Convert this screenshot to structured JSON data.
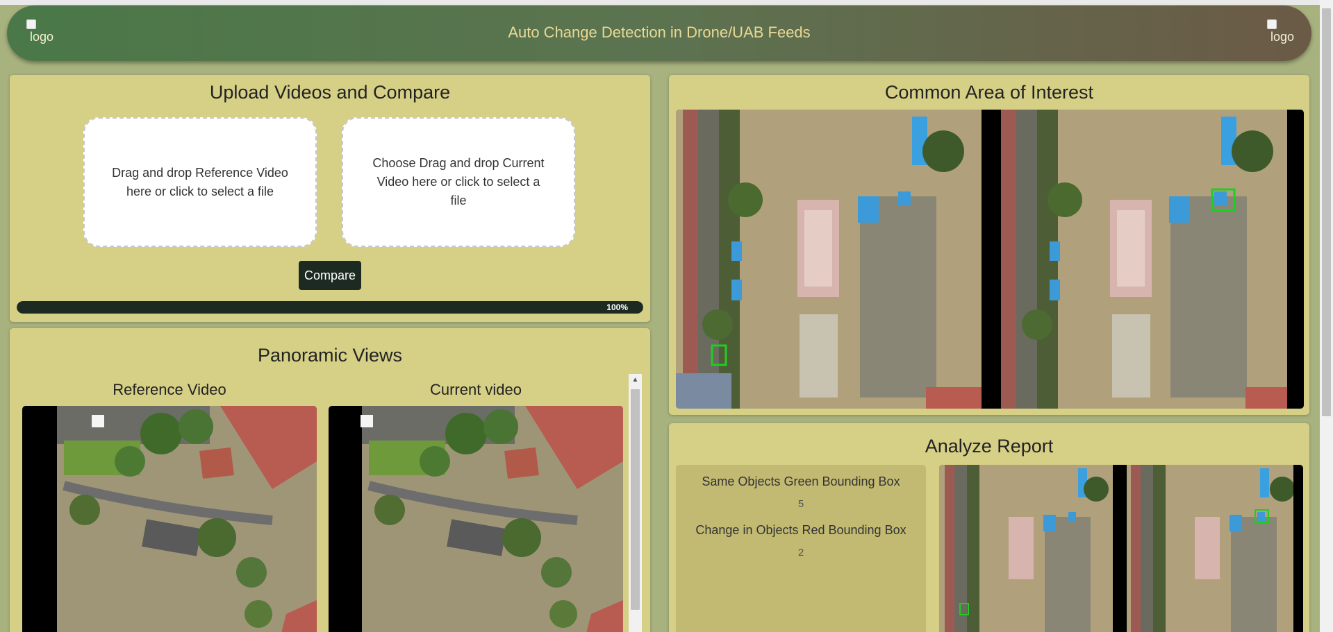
{
  "header": {
    "title": "Auto Change Detection in Drone/UAB Feeds",
    "logo_left_alt": "logo",
    "logo_right_alt": "logo"
  },
  "upload": {
    "title": "Upload Videos and Compare",
    "reference_dropzone": "Drag and drop Reference Video here or click to select a file",
    "current_dropzone": "Choose Drag and drop Current Video here or click to select a file",
    "compare_label": "Compare",
    "progress_text": "100%",
    "progress_value": 1.0
  },
  "panoramic": {
    "title": "Panoramic Views",
    "reference_label": "Reference Video",
    "current_label": "Current video"
  },
  "common_area": {
    "title": "Common Area of Interest"
  },
  "report": {
    "title": "Analyze Report",
    "same_objects_label": "Same Objects Green Bounding Box",
    "same_objects_count": "5",
    "changed_objects_label": "Change in Objects Red Bounding Box",
    "changed_objects_count": "2"
  },
  "colors": {
    "accent_dark": "#1d2a22",
    "panel_bg": "#d6cf86",
    "title_text": "#e9d995",
    "same_box": "#22cc22"
  }
}
